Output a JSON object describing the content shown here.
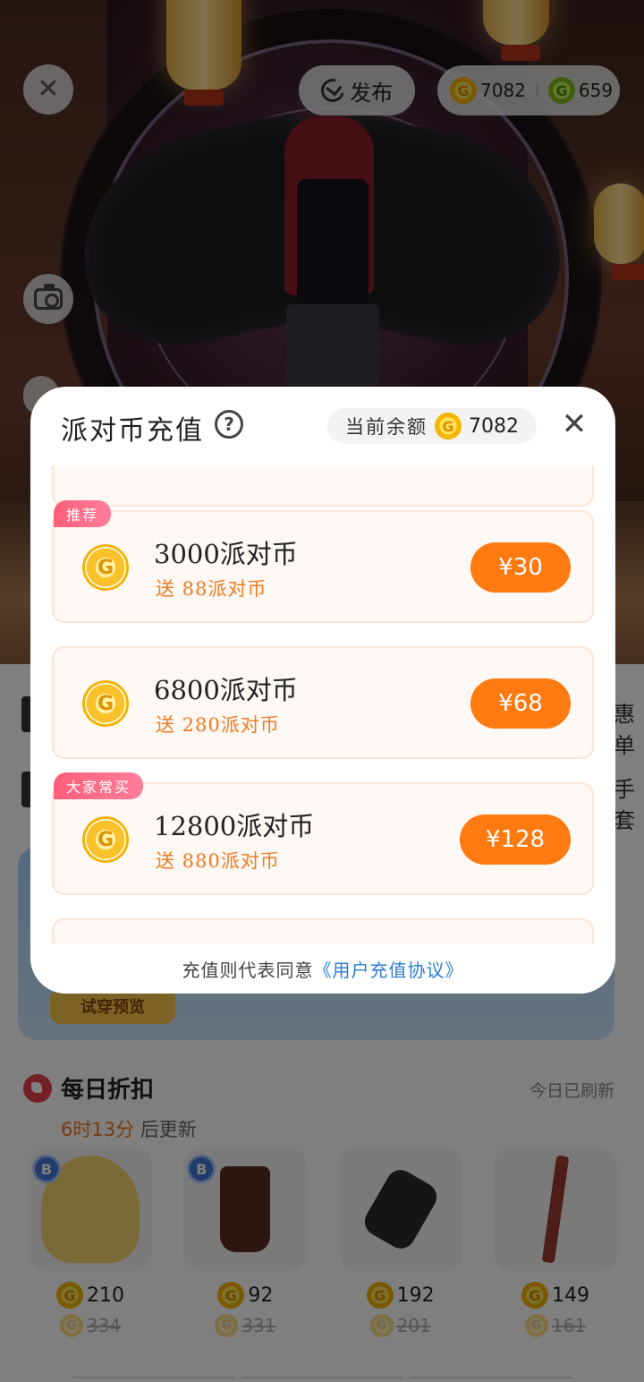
{
  "top_bar": {
    "publish_label": "发布",
    "gold_coin_balance": "7082",
    "green_coin_balance": "659"
  },
  "shop": {
    "banner_button": "试穿预览",
    "right_text_1": "惠单",
    "right_text_2": "手套",
    "daily": {
      "title": "每日折扣",
      "refreshed": "今日已刷新",
      "timer_highlight": "6时13分",
      "timer_suffix": " 后更新",
      "items": [
        {
          "price": "210",
          "old_price": "334",
          "badge": "B"
        },
        {
          "price": "92",
          "old_price": "331",
          "badge": "B"
        },
        {
          "price": "192",
          "old_price": "201"
        },
        {
          "price": "149",
          "old_price": "161"
        }
      ]
    }
  },
  "modal": {
    "title": "派对币充值",
    "help_glyph": "?",
    "balance_label": "当前余额",
    "balance_value": "7082",
    "packages": [
      {
        "tag": "推荐",
        "name": "3000派对币",
        "bonus": "送  88派对币",
        "price": "¥30"
      },
      {
        "tag": "",
        "name": "6800派对币",
        "bonus": "送  280派对币",
        "price": "¥68"
      },
      {
        "tag": "大家常买",
        "name": "12800派对币",
        "bonus": "送  880派对币",
        "price": "¥128"
      }
    ],
    "footer_text": "充值则代表同意",
    "footer_link": "《用户充值协议》"
  },
  "colors": {
    "accent_orange": "#ff7a10",
    "bonus_orange": "#f07a1e",
    "tag_pink": "#ff5f7a",
    "link_blue": "#2a7cd6"
  }
}
